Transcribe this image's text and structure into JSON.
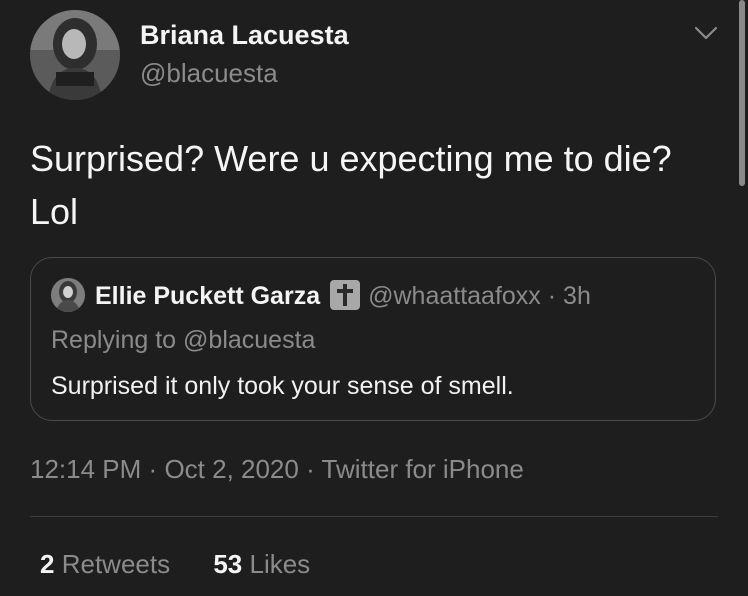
{
  "tweet": {
    "author": {
      "name": "Briana Lacuesta",
      "handle": "@blacuesta"
    },
    "text": "Surprised? Were u expecting me to die? Lol",
    "quoted": {
      "name": "Ellie Puckett Garza",
      "badge_icon": "latin-cross-emoji",
      "handle": "@whaattaafoxx",
      "separator": "·",
      "age": "3h",
      "reply_prefix": "Replying to",
      "reply_to": "@blacuesta",
      "text": "Surprised it only took your sense of smell."
    },
    "timestamp": {
      "time": "12:14 PM",
      "date": "Oct 2, 2020",
      "source": "Twitter for iPhone",
      "separator": "·"
    },
    "stats": {
      "retweets_count": "2",
      "retweets_label": "Retweets",
      "likes_count": "53",
      "likes_label": "Likes"
    }
  },
  "colors": {
    "background": "#1e1e1f",
    "primary_text": "#f4f4f4",
    "secondary_text": "#8b8b8b",
    "border": "#4a4a4a"
  },
  "icons": {
    "menu": "chevron-down-icon"
  }
}
